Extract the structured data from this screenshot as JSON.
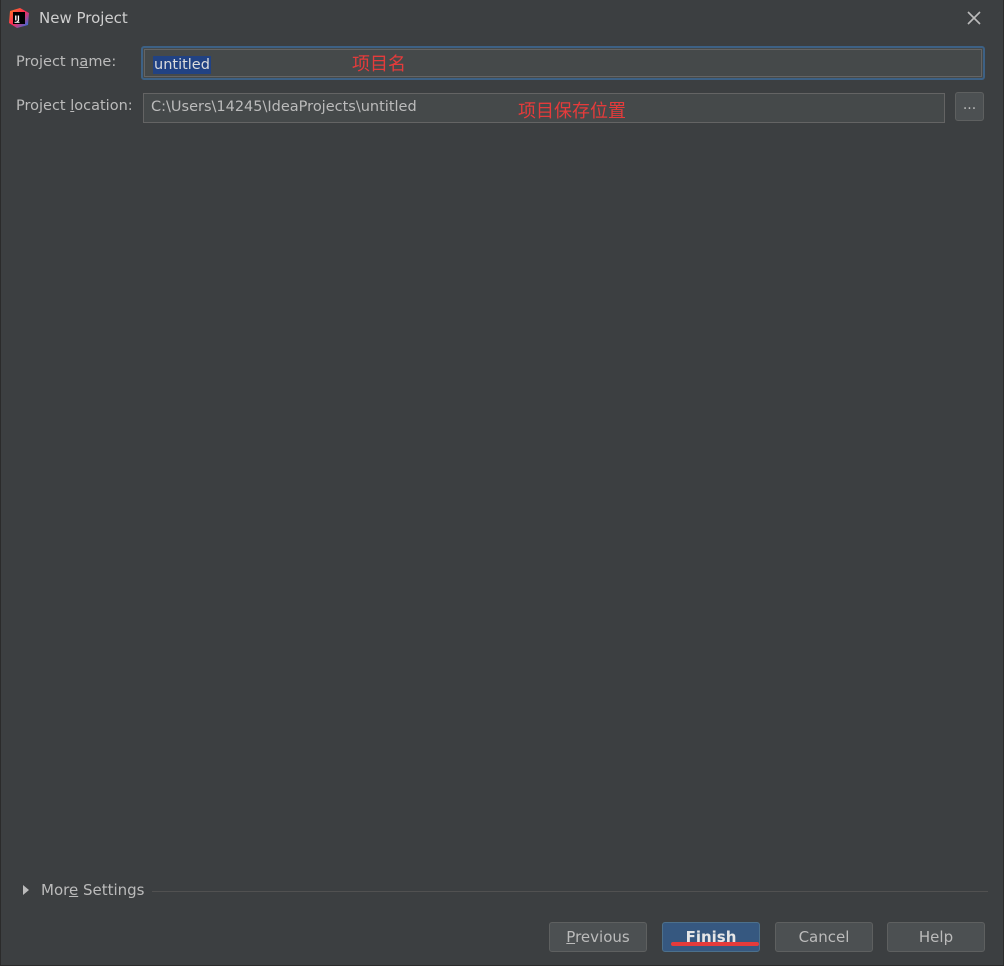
{
  "window": {
    "title": "New Project",
    "icon": "intellij-idea-icon",
    "close_icon": "close-icon"
  },
  "form": {
    "name_label_pre": "Project n",
    "name_label_u": "a",
    "name_label_post": "me:",
    "name_value": "untitled",
    "location_label_pre": "Project ",
    "location_label_u": "l",
    "location_label_post": "ocation:",
    "location_value": "C:\\Users\\14245\\IdeaProjects\\untitled",
    "browse_label": "..."
  },
  "annotations": {
    "name_note": "项目名",
    "location_note": "项目保存位置"
  },
  "more_settings": {
    "label_pre": "Mor",
    "label_u": "e",
    "label_post": " Settings",
    "expanded": false
  },
  "buttons": {
    "previous_u": "P",
    "previous_rest": "revious",
    "finish": "Finish",
    "cancel": "Cancel",
    "help": "Help"
  },
  "colors": {
    "background": "#3c3f41",
    "accent": "#365880",
    "annotation": "#e53b3b"
  }
}
